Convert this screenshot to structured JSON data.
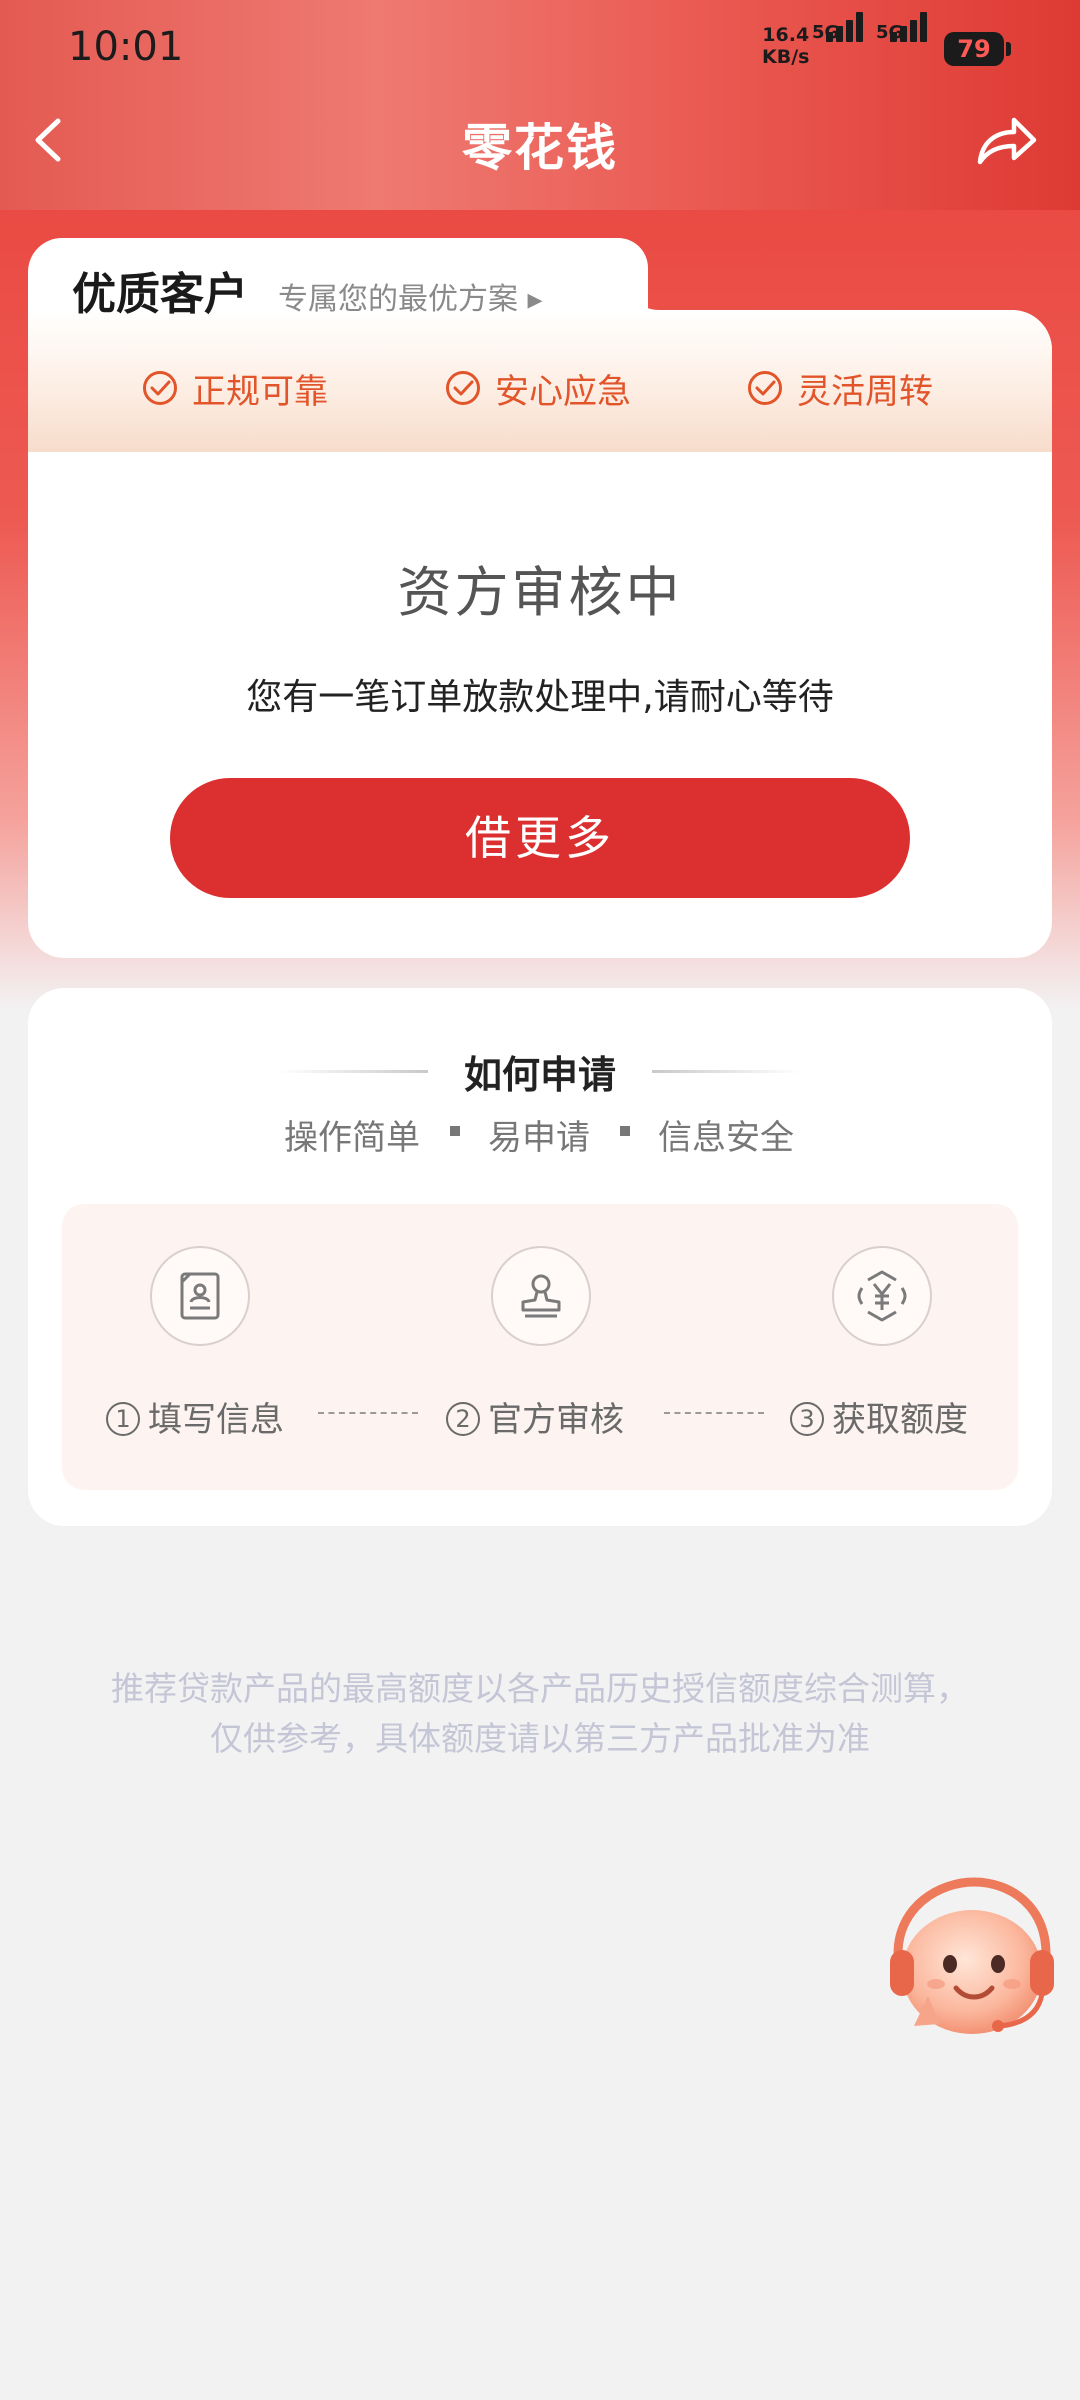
{
  "status_bar": {
    "time": "10:01",
    "net_speed_value": "16.4",
    "net_speed_unit": "KB/s",
    "sim1_label": "5G",
    "sim2_label": "5G",
    "battery": "79"
  },
  "nav": {
    "title": "零花钱",
    "back_icon": "chevron-left-icon",
    "share_icon": "share-icon"
  },
  "premium_card": {
    "title": "优质客户",
    "subtitle": "专属您的最优方案 ▸",
    "features": [
      "正规可靠",
      "安心应急",
      "灵活周转"
    ],
    "status_title": "资方审核中",
    "status_message": "您有一笔订单放款处理中,请耐心等待",
    "button_label": "借更多"
  },
  "how_to_apply": {
    "title": "如何申请",
    "tags": [
      "操作简单",
      "易申请",
      "信息安全"
    ],
    "steps": [
      {
        "num": "1",
        "label": "填写信息",
        "icon": "document-icon"
      },
      {
        "num": "2",
        "label": "官方审核",
        "icon": "stamp-icon"
      },
      {
        "num": "3",
        "label": "获取额度",
        "icon": "yuan-icon"
      }
    ]
  },
  "disclaimer": "推荐贷款产品的最高额度以各产品历史授信额度综合测算，仅供参考，具体额度请以第三方产品批准为准",
  "customer_service_icon": "customer-service-avatar-icon",
  "colors": {
    "brand_red": "#dc2f30",
    "feature_orange": "#e2552a"
  }
}
